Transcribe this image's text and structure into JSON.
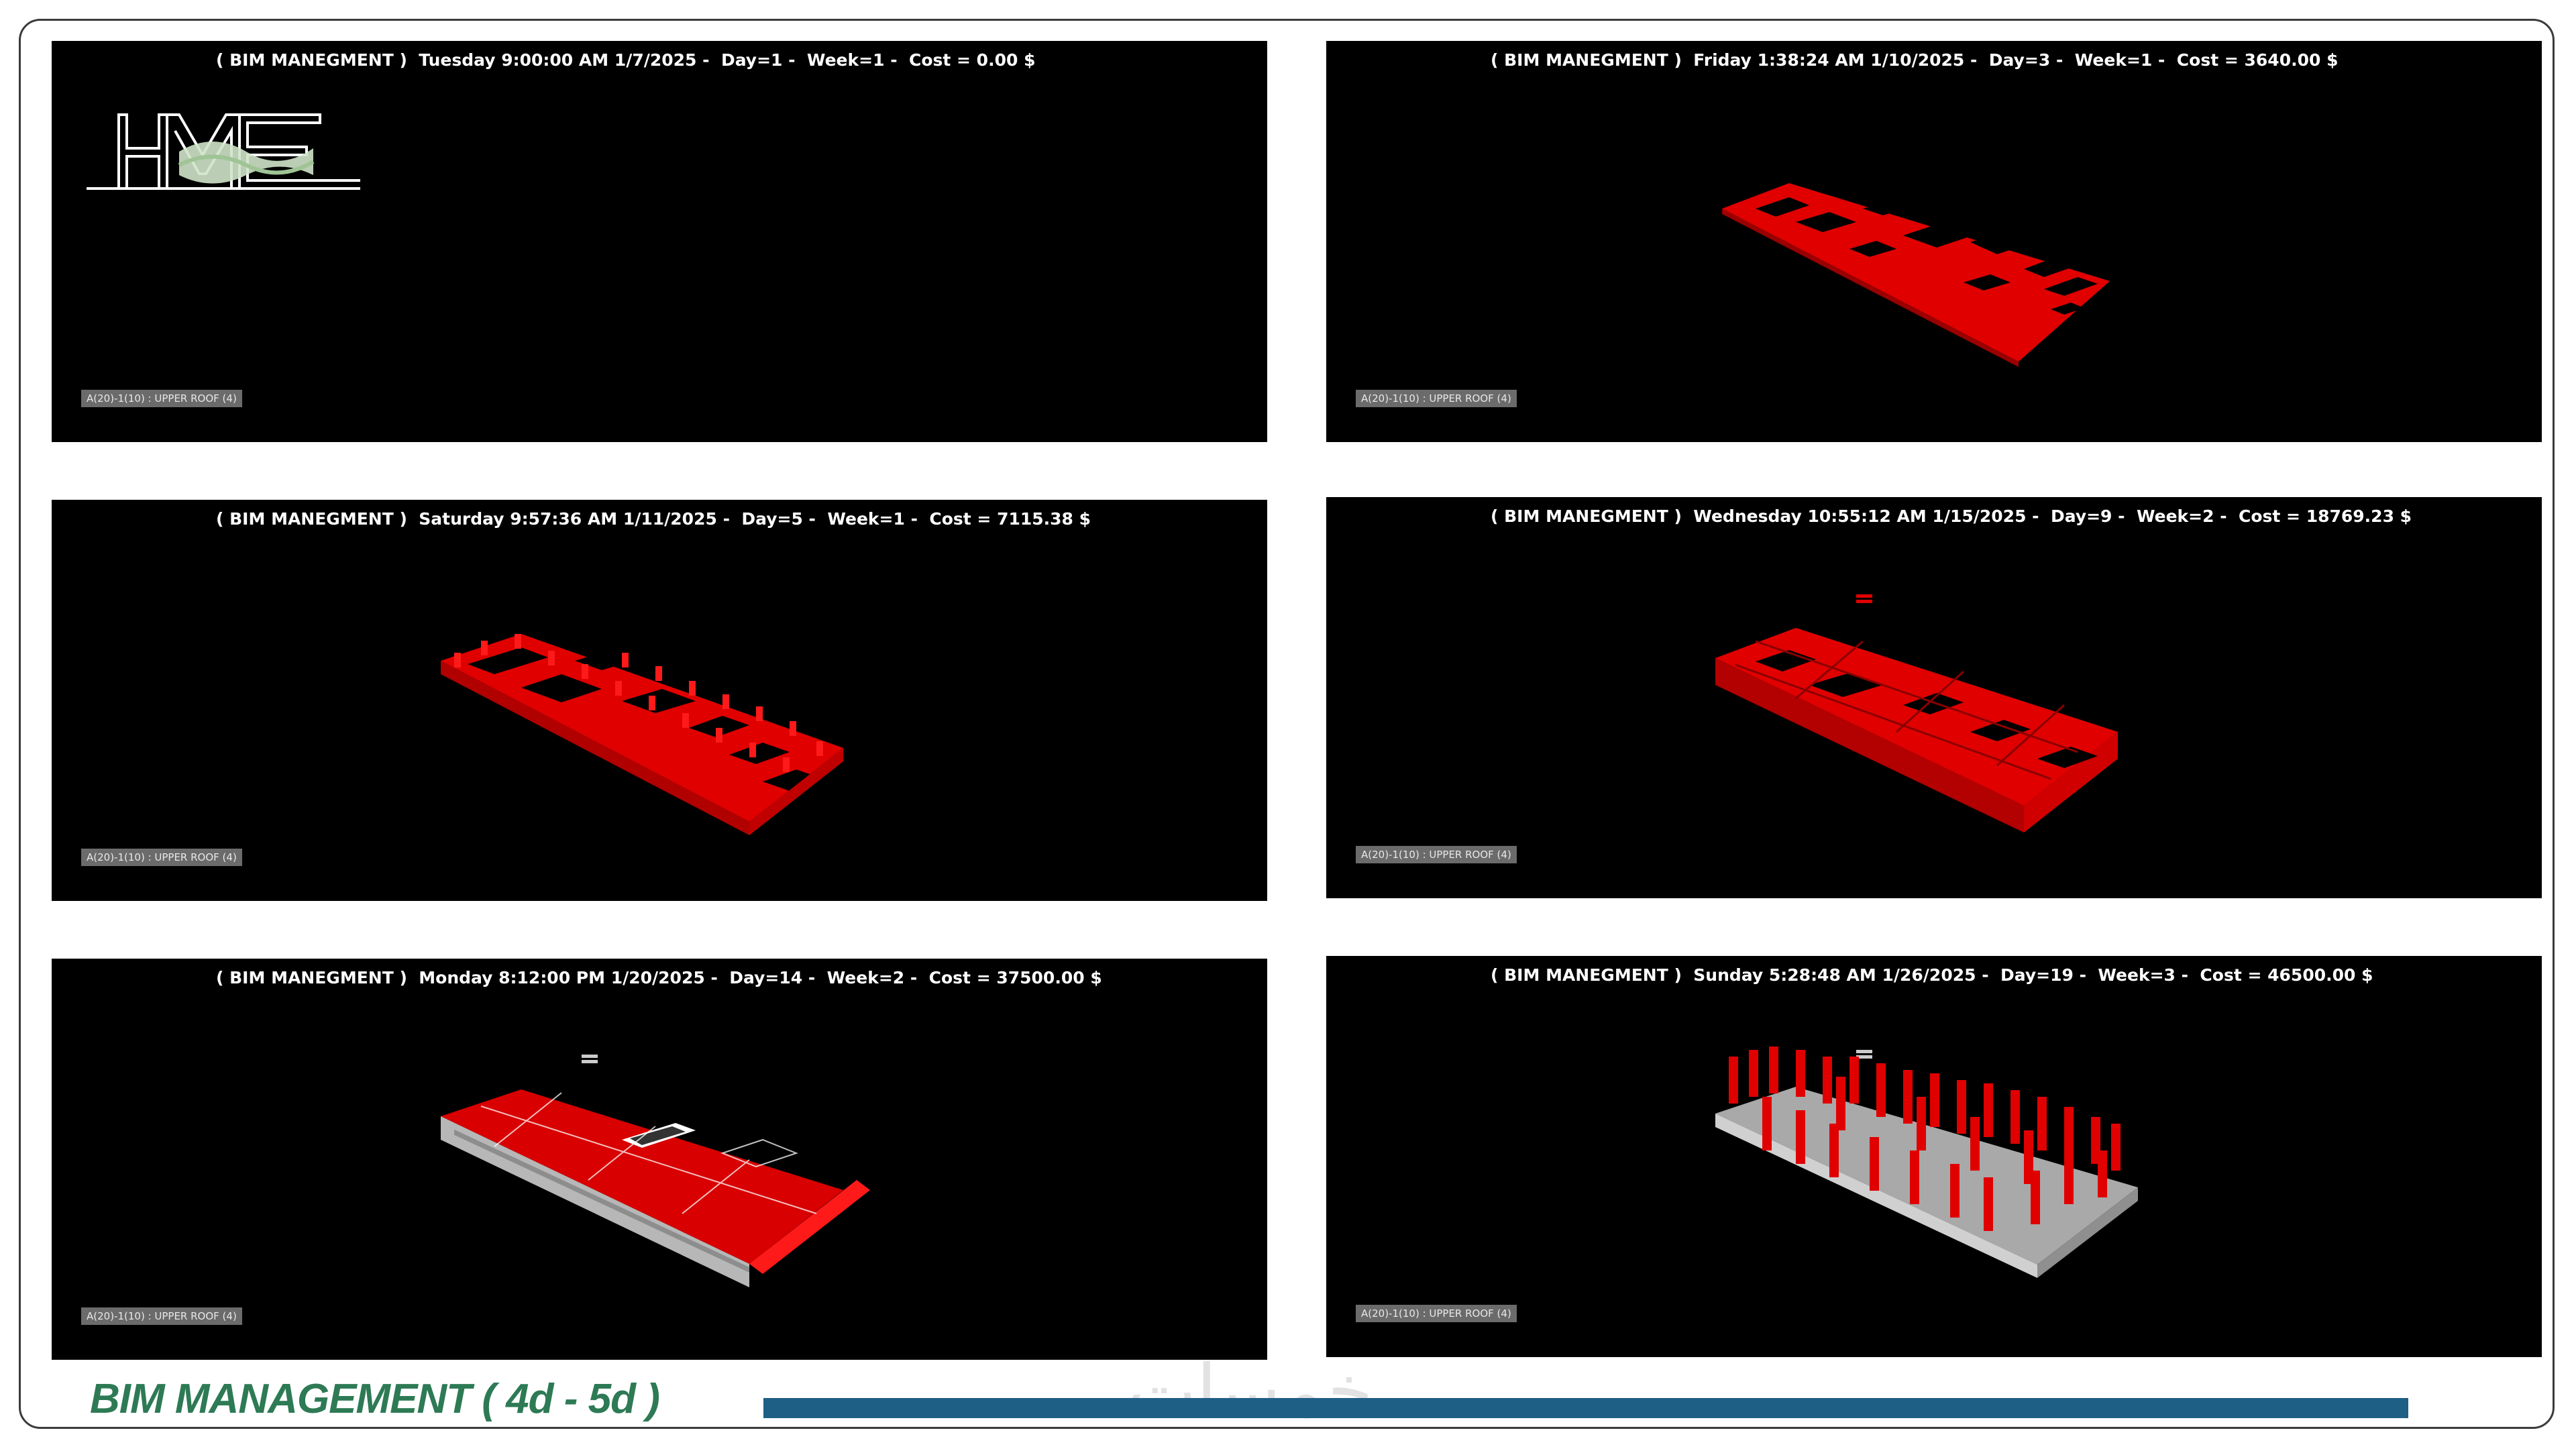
{
  "panels": [
    {
      "header": "( BIM MANEGMENT )  Tuesday 9:00:00 AM 1/7/2025 -  Day=1 -  Week=1 -  Cost = 0.00 $",
      "badge": "A(20)-1(10) : UPPER ROOF (4)"
    },
    {
      "header": "( BIM MANEGMENT )  Friday 1:38:24 AM 1/10/2025 -  Day=3 -  Week=1 -  Cost = 3640.00 $",
      "badge": "A(20)-1(10) : UPPER ROOF (4)"
    },
    {
      "header": "( BIM MANEGMENT )  Saturday 9:57:36 AM 1/11/2025 -  Day=5 -  Week=1 -  Cost = 7115.38 $",
      "badge": "A(20)-1(10) : UPPER ROOF (4)"
    },
    {
      "header": "( BIM MANEGMENT )  Wednesday 10:55:12 AM 1/15/2025 -  Day=9 -  Week=2 -  Cost = 18769.23 $",
      "badge": "A(20)-1(10) : UPPER ROOF (4)"
    },
    {
      "header": "( BIM MANEGMENT )  Monday 8:12:00 PM 1/20/2025 -  Day=14 -  Week=2 -  Cost = 37500.00 $",
      "badge": "A(20)-1(10) : UPPER ROOF (4)"
    },
    {
      "header": "( BIM MANEGMENT )  Sunday 5:28:48 AM 1/26/2025 -  Day=19 -  Week=3 -  Cost = 46500.00 $",
      "badge": "A(20)-1(10) : UPPER ROOF (4)"
    }
  ],
  "logo_text": "HME",
  "footer": {
    "title": "BIM MANAGEMENT ( 4d - 5d )",
    "watermark": "خمسات"
  },
  "colors": {
    "construction_red": "#e00000",
    "concrete_grey": "#a9a9a9",
    "footer_green": "#2d7a55",
    "footer_bar": "#1e5f86"
  }
}
